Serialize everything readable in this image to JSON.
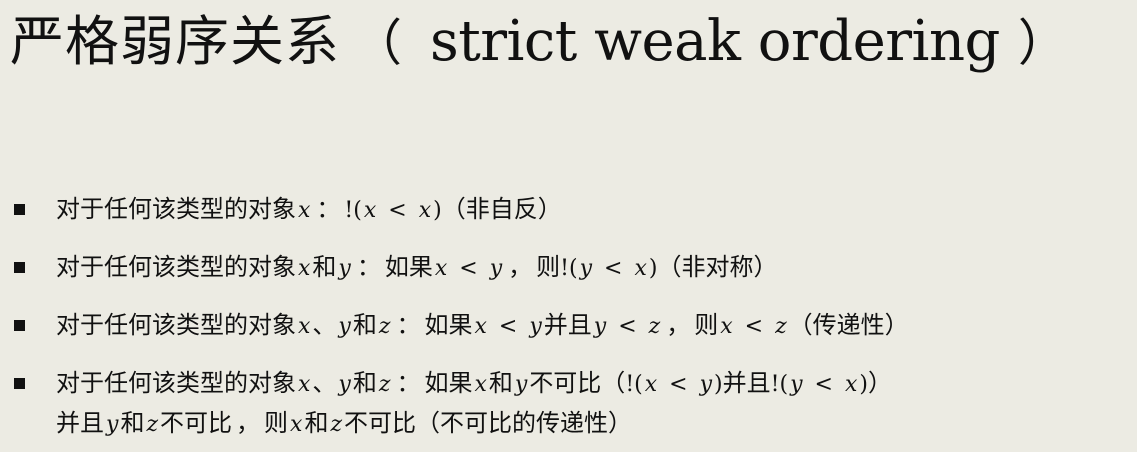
{
  "title": {
    "cn": "严格弱序关系",
    "paren_open": "（",
    "en": "strict weak ordering",
    "paren_close": "）"
  },
  "bullets": [
    {
      "lines": [
        [
          {
            "t": "txt",
            "s": "对于任何该类型的对象"
          },
          {
            "t": "var",
            "s": "x"
          },
          {
            "t": "pn",
            "s": "："
          },
          {
            "t": "sym",
            "s": "!("
          },
          {
            "t": "var",
            "s": "x"
          },
          {
            "t": "op",
            "s": "<"
          },
          {
            "t": "var",
            "s": "x"
          },
          {
            "t": "sym",
            "s": ")"
          },
          {
            "t": "txt",
            "s": "（非自反）"
          }
        ]
      ]
    },
    {
      "lines": [
        [
          {
            "t": "txt",
            "s": "对于任何该类型的对象"
          },
          {
            "t": "var",
            "s": "x"
          },
          {
            "t": "txt",
            "s": "和"
          },
          {
            "t": "var",
            "s": "y"
          },
          {
            "t": "pn",
            "s": "："
          },
          {
            "t": "txt",
            "s": "如果"
          },
          {
            "t": "var",
            "s": "x"
          },
          {
            "t": "op",
            "s": "<"
          },
          {
            "t": "var",
            "s": "y"
          },
          {
            "t": "pn",
            "s": "，"
          },
          {
            "t": "txt",
            "s": "则"
          },
          {
            "t": "sym",
            "s": "!("
          },
          {
            "t": "var",
            "s": "y"
          },
          {
            "t": "op",
            "s": "<"
          },
          {
            "t": "var",
            "s": "x"
          },
          {
            "t": "sym",
            "s": ")"
          },
          {
            "t": "txt",
            "s": "（非对称）"
          }
        ]
      ]
    },
    {
      "lines": [
        [
          {
            "t": "txt",
            "s": "对于任何该类型的对象"
          },
          {
            "t": "var",
            "s": "x"
          },
          {
            "t": "txt",
            "s": "、"
          },
          {
            "t": "var",
            "s": "y"
          },
          {
            "t": "txt",
            "s": "和"
          },
          {
            "t": "var",
            "s": "z"
          },
          {
            "t": "pn",
            "s": "："
          },
          {
            "t": "txt",
            "s": "如果"
          },
          {
            "t": "var",
            "s": "x"
          },
          {
            "t": "op",
            "s": "<"
          },
          {
            "t": "var",
            "s": "y"
          },
          {
            "t": "txt",
            "s": "并且"
          },
          {
            "t": "var",
            "s": "y"
          },
          {
            "t": "op",
            "s": "<"
          },
          {
            "t": "var",
            "s": "z"
          },
          {
            "t": "pn",
            "s": "，"
          },
          {
            "t": "txt",
            "s": "则"
          },
          {
            "t": "var",
            "s": "x"
          },
          {
            "t": "op",
            "s": "<"
          },
          {
            "t": "var",
            "s": "z"
          },
          {
            "t": "txt",
            "s": "（传递性）"
          }
        ]
      ]
    },
    {
      "lines": [
        [
          {
            "t": "txt",
            "s": "对于任何该类型的对象"
          },
          {
            "t": "var",
            "s": "x"
          },
          {
            "t": "txt",
            "s": "、"
          },
          {
            "t": "var",
            "s": "y"
          },
          {
            "t": "txt",
            "s": "和"
          },
          {
            "t": "var",
            "s": "z"
          },
          {
            "t": "pn",
            "s": "："
          },
          {
            "t": "txt",
            "s": "如果"
          },
          {
            "t": "var",
            "s": "x"
          },
          {
            "t": "txt",
            "s": "和"
          },
          {
            "t": "var",
            "s": "y"
          },
          {
            "t": "txt",
            "s": "不可比（"
          },
          {
            "t": "sym",
            "s": "!("
          },
          {
            "t": "var",
            "s": "x"
          },
          {
            "t": "op",
            "s": "<"
          },
          {
            "t": "var",
            "s": "y"
          },
          {
            "t": "sym",
            "s": ")"
          },
          {
            "t": "txt",
            "s": "并且"
          },
          {
            "t": "sym",
            "s": "!("
          },
          {
            "t": "var",
            "s": "y"
          },
          {
            "t": "op",
            "s": "<"
          },
          {
            "t": "var",
            "s": "x"
          },
          {
            "t": "sym",
            "s": ")"
          },
          {
            "t": "txt",
            "s": "）"
          }
        ],
        [
          {
            "t": "txt",
            "s": "并且"
          },
          {
            "t": "var",
            "s": "y"
          },
          {
            "t": "txt",
            "s": "和"
          },
          {
            "t": "var",
            "s": "z"
          },
          {
            "t": "txt",
            "s": "不可比"
          },
          {
            "t": "pn",
            "s": "，"
          },
          {
            "t": "txt",
            "s": "则"
          },
          {
            "t": "var",
            "s": "x"
          },
          {
            "t": "txt",
            "s": "和"
          },
          {
            "t": "var",
            "s": "z"
          },
          {
            "t": "txt",
            "s": "不可比（不可比的传递性）"
          }
        ]
      ]
    }
  ]
}
